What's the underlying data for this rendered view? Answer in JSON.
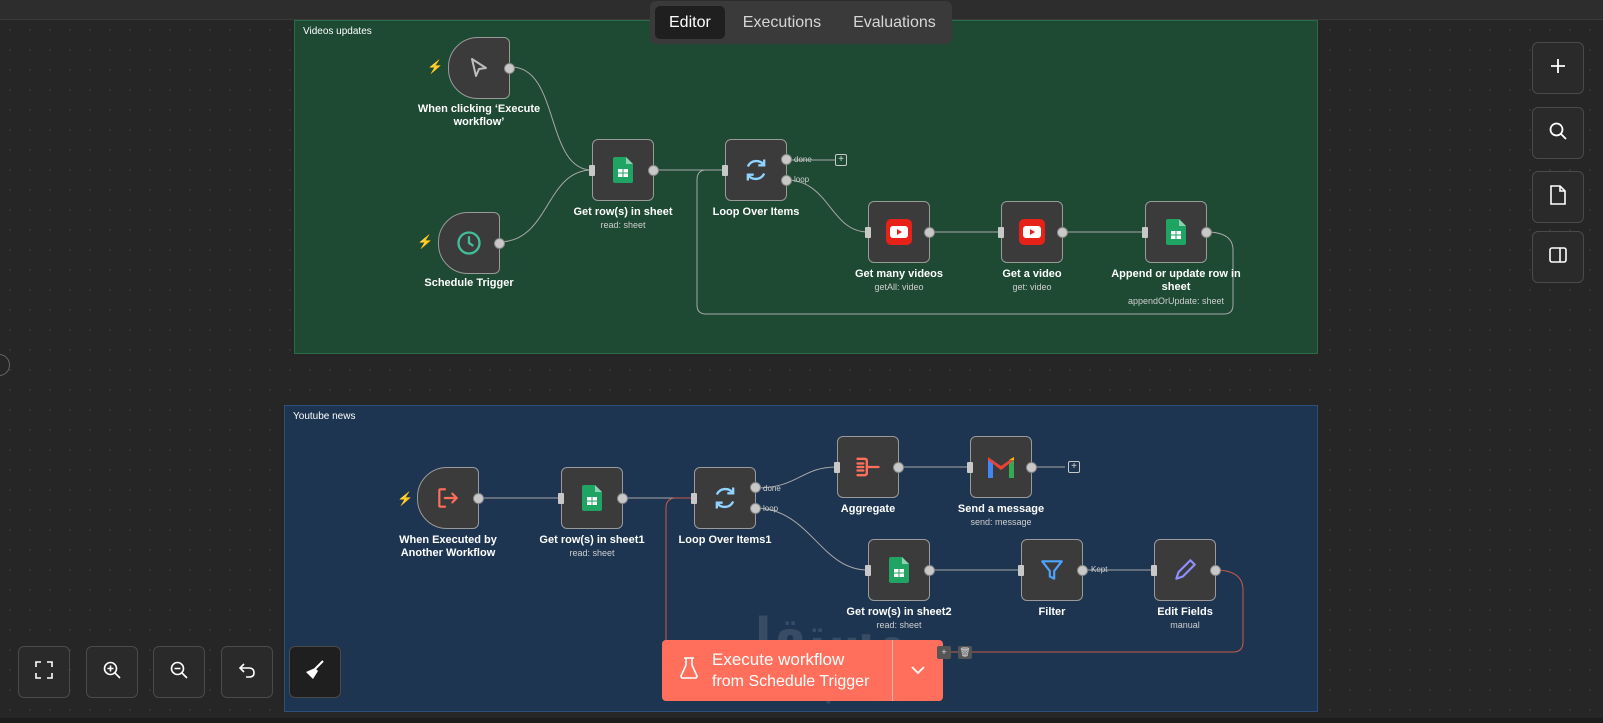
{
  "tabs": [
    "Editor",
    "Executions",
    "Evaluations"
  ],
  "sticky_notes": [
    {
      "title": "Videos updates",
      "color": "#1e4933"
    },
    {
      "title": "Youtube news",
      "color": "#1d3550"
    }
  ],
  "nodes": {
    "manual_trigger": {
      "label": "When clicking ‘Execute workflow’",
      "icon": "cursor-icon"
    },
    "schedule_trigger": {
      "label": "Schedule Trigger",
      "icon": "clock-icon"
    },
    "get_rows": {
      "label": "Get row(s) in sheet",
      "sub": "read: sheet",
      "icon": "google-sheets-icon"
    },
    "loop": {
      "label": "Loop Over Items",
      "icon": "loop-icon"
    },
    "get_many_videos": {
      "label": "Get many videos",
      "sub": "getAll: video",
      "icon": "youtube-icon"
    },
    "get_video": {
      "label": "Get a video",
      "sub": "get: video",
      "icon": "youtube-icon"
    },
    "append_row": {
      "label": "Append or update row in sheet",
      "sub": "appendOrUpdate: sheet",
      "icon": "google-sheets-icon"
    },
    "exec_by_workflow": {
      "label": "When Executed by Another Workflow",
      "icon": "sign-in-icon"
    },
    "get_rows1": {
      "label": "Get row(s) in sheet1",
      "sub": "read: sheet",
      "icon": "google-sheets-icon"
    },
    "loop1": {
      "label": "Loop Over Items1",
      "icon": "loop-icon"
    },
    "aggregate": {
      "label": "Aggregate",
      "icon": "aggregate-icon"
    },
    "send_message": {
      "label": "Send a message",
      "sub": "send: message",
      "icon": "gmail-icon"
    },
    "get_rows2": {
      "label": "Get row(s) in sheet2",
      "sub": "read: sheet",
      "icon": "google-sheets-icon"
    },
    "filter": {
      "label": "Filter",
      "icon": "filter-icon"
    },
    "edit_fields": {
      "label": "Edit Fields",
      "sub": "manual",
      "icon": "pencil-icon"
    }
  },
  "port_labels": {
    "done": "done",
    "loop": "loop",
    "kept": "Kept"
  },
  "execute_button": {
    "line1": "Execute workflow",
    "line2": "from Schedule Trigger"
  },
  "watermark": {
    "arabic": "مستقل",
    "latin": "mostaql.com"
  },
  "colors": {
    "accent": "#ff6f5c",
    "sheets": "#1fa463",
    "youtube": "#e62117",
    "filter": "#4ea3ff",
    "pencil": "#8f8fff",
    "loop": "#8fd3ff"
  }
}
